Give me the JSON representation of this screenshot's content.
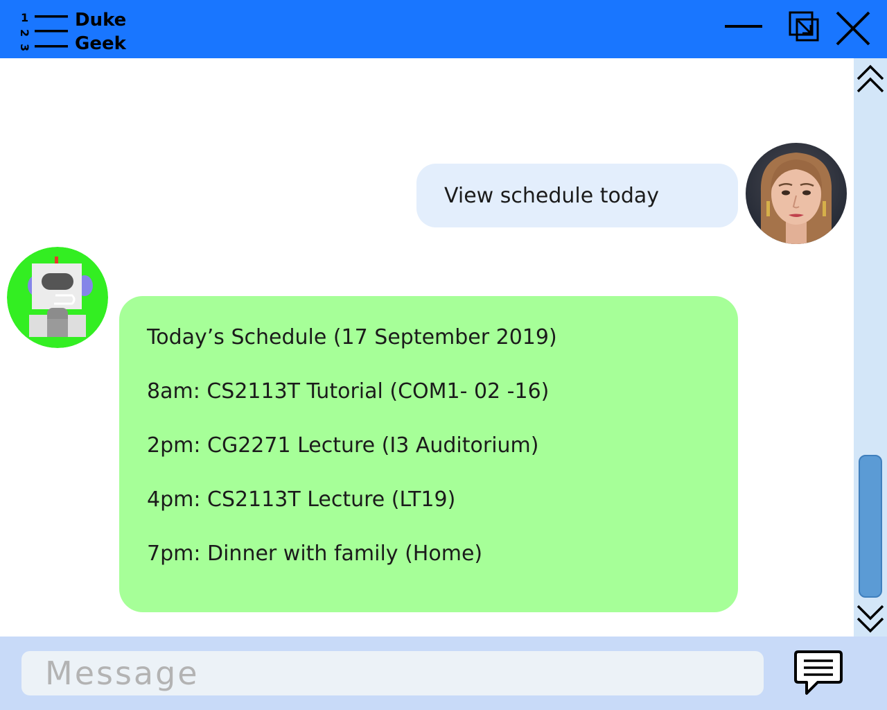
{
  "app": {
    "logo_digits": [
      "1",
      "2",
      "3"
    ],
    "name_line1": "Duke",
    "name_line2": "Geek",
    "brand_color": "#1976ff"
  },
  "window_controls": [
    "minimize-icon",
    "restore-icon",
    "close-icon"
  ],
  "messages": {
    "user": {
      "text": "View schedule today",
      "bubble_color": "#e3eefc"
    },
    "bot": {
      "bubble_color": "#a6ff98",
      "lines": [
        "Today’s Schedule (17 September 2019)",
        "8am: CS2113T Tutorial (COM1- 02 -16)",
        "2pm: CG2271 Lecture (I3 Auditorium)",
        "4pm: CS2113T Lecture (LT19)",
        "7pm: Dinner with family (Home)"
      ]
    }
  },
  "scrollbar": {
    "up_icon": "double-chevron-up-icon",
    "down_icon": "double-chevron-down-icon",
    "position_fraction": 1.0
  },
  "input": {
    "placeholder": "Message",
    "value": ""
  },
  "send_icon": "chat-bubble-icon"
}
